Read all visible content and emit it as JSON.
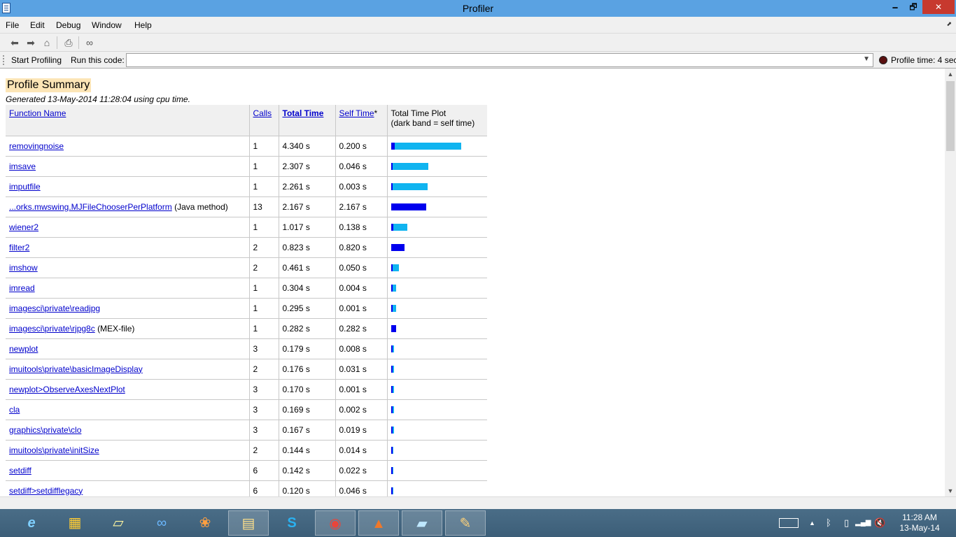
{
  "window": {
    "title": "Profiler",
    "min_glyph": "🗕",
    "max_glyph": "🗗",
    "close_glyph": "✕"
  },
  "menu": {
    "items": [
      "File",
      "Edit",
      "Debug",
      "Window",
      "Help"
    ],
    "undock_glyph": "⬈"
  },
  "toolbar": {
    "icons": [
      "back-arrow-icon",
      "forward-arrow-icon",
      "home-icon",
      "print-icon",
      "find-binoculars-icon"
    ]
  },
  "runbar": {
    "start_label": "Start Profiling",
    "run_label": "Run this code:",
    "code_value": "",
    "profile_time": "Profile time: 4 sec"
  },
  "summary": {
    "title": "Profile Summary",
    "generated": "Generated 13-May-2014 11:28:04 using cpu time.",
    "columns": {
      "function_name": "Function Name",
      "calls": "Calls",
      "total_time": "Total Time",
      "self_time": "Self Time",
      "self_time_suffix": "*",
      "plot_line1": "Total Time Plot",
      "plot_line2": "(dark band = self time)"
    },
    "rows": [
      {
        "name": "removingnoise",
        "note": "",
        "calls": "1",
        "total": "4.340 s",
        "self": "0.200 s",
        "total_frac": 1.0,
        "self_frac": 0.046
      },
      {
        "name": "imsave",
        "note": "",
        "calls": "1",
        "total": "2.307 s",
        "self": "0.046 s",
        "total_frac": 0.532,
        "self_frac": 0.011
      },
      {
        "name": "imputfile",
        "note": "",
        "calls": "1",
        "total": "2.261 s",
        "self": "0.003 s",
        "total_frac": 0.521,
        "self_frac": 0.001
      },
      {
        "name": "...orks.mwswing.MJFileChooserPerPlatform",
        "note": "(Java method)",
        "calls": "13",
        "total": "2.167 s",
        "self": "2.167 s",
        "total_frac": 0.499,
        "self_frac": 0.499
      },
      {
        "name": "wiener2",
        "note": "",
        "calls": "1",
        "total": "1.017 s",
        "self": "0.138 s",
        "total_frac": 0.234,
        "self_frac": 0.032
      },
      {
        "name": "filter2",
        "note": "",
        "calls": "2",
        "total": "0.823 s",
        "self": "0.820 s",
        "total_frac": 0.19,
        "self_frac": 0.189
      },
      {
        "name": "imshow",
        "note": "",
        "calls": "2",
        "total": "0.461 s",
        "self": "0.050 s",
        "total_frac": 0.106,
        "self_frac": 0.012
      },
      {
        "name": "imread",
        "note": "",
        "calls": "1",
        "total": "0.304 s",
        "self": "0.004 s",
        "total_frac": 0.07,
        "self_frac": 0.001
      },
      {
        "name": "imagesci\\private\\readjpg",
        "note": "",
        "calls": "1",
        "total": "0.295 s",
        "self": "0.001 s",
        "total_frac": 0.068,
        "self_frac": 0.0
      },
      {
        "name": "imagesci\\private\\rjpg8c",
        "note": "(MEX-file)",
        "calls": "1",
        "total": "0.282 s",
        "self": "0.282 s",
        "total_frac": 0.065,
        "self_frac": 0.065
      },
      {
        "name": "newplot",
        "note": "",
        "calls": "3",
        "total": "0.179 s",
        "self": "0.008 s",
        "total_frac": 0.041,
        "self_frac": 0.002
      },
      {
        "name": "imuitools\\private\\basicImageDisplay",
        "note": "",
        "calls": "2",
        "total": "0.176 s",
        "self": "0.031 s",
        "total_frac": 0.041,
        "self_frac": 0.007
      },
      {
        "name": "newplot>ObserveAxesNextPlot",
        "note": "",
        "calls": "3",
        "total": "0.170 s",
        "self": "0.001 s",
        "total_frac": 0.039,
        "self_frac": 0.0
      },
      {
        "name": "cla",
        "note": "",
        "calls": "3",
        "total": "0.169 s",
        "self": "0.002 s",
        "total_frac": 0.039,
        "self_frac": 0.0
      },
      {
        "name": "graphics\\private\\clo",
        "note": "",
        "calls": "3",
        "total": "0.167 s",
        "self": "0.019 s",
        "total_frac": 0.038,
        "self_frac": 0.004
      },
      {
        "name": "imuitools\\private\\initSize",
        "note": "",
        "calls": "2",
        "total": "0.144 s",
        "self": "0.014 s",
        "total_frac": 0.033,
        "self_frac": 0.003
      },
      {
        "name": "setdiff",
        "note": "",
        "calls": "6",
        "total": "0.142 s",
        "self": "0.022 s",
        "total_frac": 0.033,
        "self_frac": 0.005
      },
      {
        "name": "setdiff>setdifflegacy",
        "note": "",
        "calls": "6",
        "total": "0.120 s",
        "self": "0.046 s",
        "total_frac": 0.028,
        "self_frac": 0.011
      }
    ]
  },
  "colors": {
    "total_bar": "#10b4f0",
    "self_bar": "#0000ee",
    "title_highlight": "#fce5b6",
    "titlebar": "#5aa2e2",
    "close_button": "#c7392e"
  },
  "taskbar": {
    "apps": [
      {
        "icon": "internet-explorer-icon",
        "glyph": "e"
      },
      {
        "icon": "windows-flag-icon",
        "glyph": "▦"
      },
      {
        "icon": "sticky-notes-icon",
        "glyph": "▱"
      },
      {
        "icon": "infinity-app-icon",
        "glyph": "∞"
      },
      {
        "icon": "picasa-icon",
        "glyph": "❀"
      },
      {
        "icon": "file-explorer-icon",
        "glyph": "▤"
      },
      {
        "icon": "skype-icon",
        "glyph": "S"
      },
      {
        "icon": "chrome-icon",
        "glyph": "◉"
      },
      {
        "icon": "matlab-icon",
        "glyph": "▲"
      },
      {
        "icon": "notepad-icon",
        "glyph": "▰"
      },
      {
        "icon": "paint-icon",
        "glyph": "✎"
      }
    ],
    "tray": {
      "up_glyph": "▲",
      "bluetooth_glyph": "ᛒ",
      "battery_glyph": "▯",
      "signal_glyph": "▂▄▆",
      "volume_glyph": "🔇"
    },
    "clock_time": "11:28 AM",
    "clock_date": "13-May-14"
  }
}
